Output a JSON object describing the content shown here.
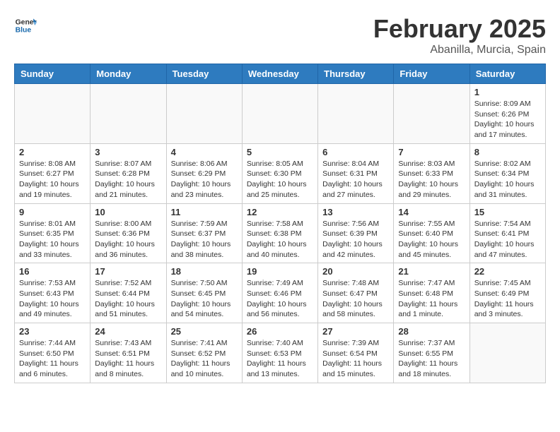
{
  "header": {
    "logo_line1": "General",
    "logo_line2": "Blue",
    "month": "February 2025",
    "location": "Abanilla, Murcia, Spain"
  },
  "days_of_week": [
    "Sunday",
    "Monday",
    "Tuesday",
    "Wednesday",
    "Thursday",
    "Friday",
    "Saturday"
  ],
  "weeks": [
    {
      "days": [
        {
          "num": "",
          "info": ""
        },
        {
          "num": "",
          "info": ""
        },
        {
          "num": "",
          "info": ""
        },
        {
          "num": "",
          "info": ""
        },
        {
          "num": "",
          "info": ""
        },
        {
          "num": "",
          "info": ""
        },
        {
          "num": "1",
          "info": "Sunrise: 8:09 AM\nSunset: 6:26 PM\nDaylight: 10 hours and 17 minutes."
        }
      ]
    },
    {
      "days": [
        {
          "num": "2",
          "info": "Sunrise: 8:08 AM\nSunset: 6:27 PM\nDaylight: 10 hours and 19 minutes."
        },
        {
          "num": "3",
          "info": "Sunrise: 8:07 AM\nSunset: 6:28 PM\nDaylight: 10 hours and 21 minutes."
        },
        {
          "num": "4",
          "info": "Sunrise: 8:06 AM\nSunset: 6:29 PM\nDaylight: 10 hours and 23 minutes."
        },
        {
          "num": "5",
          "info": "Sunrise: 8:05 AM\nSunset: 6:30 PM\nDaylight: 10 hours and 25 minutes."
        },
        {
          "num": "6",
          "info": "Sunrise: 8:04 AM\nSunset: 6:31 PM\nDaylight: 10 hours and 27 minutes."
        },
        {
          "num": "7",
          "info": "Sunrise: 8:03 AM\nSunset: 6:33 PM\nDaylight: 10 hours and 29 minutes."
        },
        {
          "num": "8",
          "info": "Sunrise: 8:02 AM\nSunset: 6:34 PM\nDaylight: 10 hours and 31 minutes."
        }
      ]
    },
    {
      "days": [
        {
          "num": "9",
          "info": "Sunrise: 8:01 AM\nSunset: 6:35 PM\nDaylight: 10 hours and 33 minutes."
        },
        {
          "num": "10",
          "info": "Sunrise: 8:00 AM\nSunset: 6:36 PM\nDaylight: 10 hours and 36 minutes."
        },
        {
          "num": "11",
          "info": "Sunrise: 7:59 AM\nSunset: 6:37 PM\nDaylight: 10 hours and 38 minutes."
        },
        {
          "num": "12",
          "info": "Sunrise: 7:58 AM\nSunset: 6:38 PM\nDaylight: 10 hours and 40 minutes."
        },
        {
          "num": "13",
          "info": "Sunrise: 7:56 AM\nSunset: 6:39 PM\nDaylight: 10 hours and 42 minutes."
        },
        {
          "num": "14",
          "info": "Sunrise: 7:55 AM\nSunset: 6:40 PM\nDaylight: 10 hours and 45 minutes."
        },
        {
          "num": "15",
          "info": "Sunrise: 7:54 AM\nSunset: 6:41 PM\nDaylight: 10 hours and 47 minutes."
        }
      ]
    },
    {
      "days": [
        {
          "num": "16",
          "info": "Sunrise: 7:53 AM\nSunset: 6:43 PM\nDaylight: 10 hours and 49 minutes."
        },
        {
          "num": "17",
          "info": "Sunrise: 7:52 AM\nSunset: 6:44 PM\nDaylight: 10 hours and 51 minutes."
        },
        {
          "num": "18",
          "info": "Sunrise: 7:50 AM\nSunset: 6:45 PM\nDaylight: 10 hours and 54 minutes."
        },
        {
          "num": "19",
          "info": "Sunrise: 7:49 AM\nSunset: 6:46 PM\nDaylight: 10 hours and 56 minutes."
        },
        {
          "num": "20",
          "info": "Sunrise: 7:48 AM\nSunset: 6:47 PM\nDaylight: 10 hours and 58 minutes."
        },
        {
          "num": "21",
          "info": "Sunrise: 7:47 AM\nSunset: 6:48 PM\nDaylight: 11 hours and 1 minute."
        },
        {
          "num": "22",
          "info": "Sunrise: 7:45 AM\nSunset: 6:49 PM\nDaylight: 11 hours and 3 minutes."
        }
      ]
    },
    {
      "days": [
        {
          "num": "23",
          "info": "Sunrise: 7:44 AM\nSunset: 6:50 PM\nDaylight: 11 hours and 6 minutes."
        },
        {
          "num": "24",
          "info": "Sunrise: 7:43 AM\nSunset: 6:51 PM\nDaylight: 11 hours and 8 minutes."
        },
        {
          "num": "25",
          "info": "Sunrise: 7:41 AM\nSunset: 6:52 PM\nDaylight: 11 hours and 10 minutes."
        },
        {
          "num": "26",
          "info": "Sunrise: 7:40 AM\nSunset: 6:53 PM\nDaylight: 11 hours and 13 minutes."
        },
        {
          "num": "27",
          "info": "Sunrise: 7:39 AM\nSunset: 6:54 PM\nDaylight: 11 hours and 15 minutes."
        },
        {
          "num": "28",
          "info": "Sunrise: 7:37 AM\nSunset: 6:55 PM\nDaylight: 11 hours and 18 minutes."
        },
        {
          "num": "",
          "info": ""
        }
      ]
    }
  ]
}
